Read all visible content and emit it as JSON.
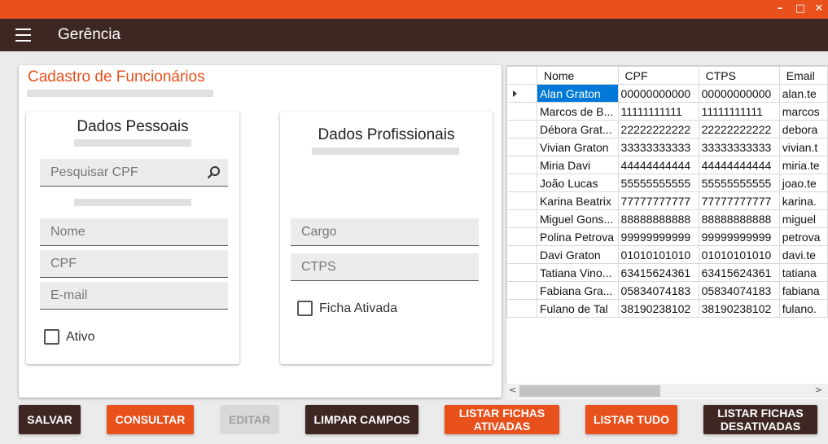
{
  "window": {
    "controls": [
      "–",
      "□",
      "✕"
    ]
  },
  "appbar": {
    "title": "Gerência"
  },
  "form": {
    "title": "Cadastro de Funcionários",
    "personal": {
      "title": "Dados Pessoais",
      "search_placeholder": "Pesquisar CPF",
      "name_placeholder": "Nome",
      "cpf_placeholder": "CPF",
      "email_placeholder": "E-mail",
      "active_label": "Ativo"
    },
    "professional": {
      "title": "Dados Profissionais",
      "role_placeholder": "Cargo",
      "ctps_placeholder": "CTPS",
      "record_active_label": "Ficha Ativada"
    }
  },
  "grid": {
    "columns": [
      "Nome",
      "CPF",
      "CTPS",
      "Email"
    ],
    "rows": [
      [
        "Alan Graton",
        "00000000000",
        "00000000000",
        "alan.te"
      ],
      [
        "Marcos de B...",
        "11111111111",
        "11111111111",
        "marcos"
      ],
      [
        "Débora Grat...",
        "22222222222",
        "22222222222",
        "debora"
      ],
      [
        "Vivian Graton",
        "33333333333",
        "33333333333",
        "vivian.t"
      ],
      [
        "Miria Davi",
        "44444444444",
        "44444444444",
        "miria.te"
      ],
      [
        "João Lucas",
        "55555555555",
        "55555555555",
        "joao.te"
      ],
      [
        "Karina Beatrix",
        "77777777777",
        "77777777777",
        "karina."
      ],
      [
        "Miguel Gons...",
        "88888888888",
        "88888888888",
        "miguel"
      ],
      [
        "Polina Petrova",
        "99999999999",
        "99999999999",
        "petrova"
      ],
      [
        "Davi Graton",
        "01010101010",
        "01010101010",
        "davi.te"
      ],
      [
        "Tatiana Vino...",
        "63415624361",
        "63415624361",
        "tatiana"
      ],
      [
        "Fabiana Gra...",
        "05834074183",
        "05834074183",
        "fabiana"
      ],
      [
        "Fulano de Tal",
        "38190238102",
        "38190238102",
        "fulano."
      ]
    ]
  },
  "buttons": {
    "save": "SALVAR",
    "consult": "CONSULTAR",
    "edit": "EDITAR",
    "clear": "LIMPAR CAMPOS",
    "list_active": "LISTAR FICHAS ATIVADAS",
    "list_all": "LISTAR TUDO",
    "list_inactive": "LISTAR FICHAS DESATIVADAS"
  },
  "colors": {
    "accent": "#e8501c",
    "dark": "#3e2723",
    "selection": "#0078d7"
  }
}
